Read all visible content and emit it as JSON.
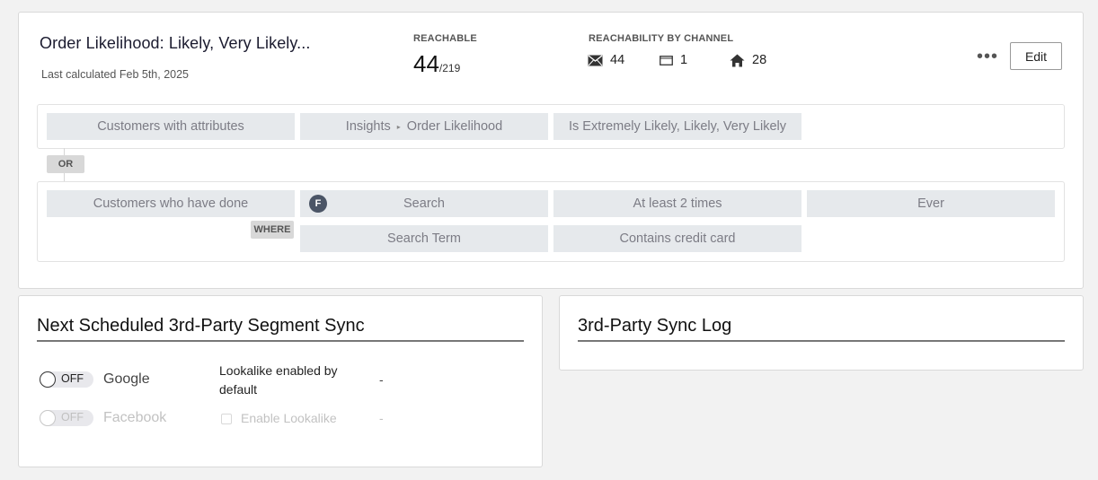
{
  "segment": {
    "title": "Order Likelihood: Likely, Very Likely...",
    "last_calculated": "Last calculated Feb 5th, 2025"
  },
  "reachable": {
    "label": "REACHABLE",
    "count": "44",
    "total": "/219"
  },
  "channels": {
    "label": "REACHABILITY BY CHANNEL",
    "items": [
      {
        "icon": "email-icon",
        "count": "44"
      },
      {
        "icon": "sms-icon",
        "count": "1"
      },
      {
        "icon": "home-icon",
        "count": "28"
      }
    ]
  },
  "toolbar": {
    "more_label": "•••",
    "edit_label": "Edit"
  },
  "conditions": {
    "group1": {
      "type": "Customers with attributes",
      "attribute_source": "Insights",
      "attribute_name": "Order Likelihood",
      "operator": "Is Extremely Likely, Likely, Very Likely"
    },
    "joiner": "OR",
    "group2": {
      "type": "Customers who have done",
      "event_badge": "F",
      "event": "Search",
      "frequency": "At least 2 times",
      "timeframe": "Ever",
      "where_label": "WHERE",
      "property": "Search Term",
      "property_operator": "Contains credit card"
    }
  },
  "sync": {
    "title": "Next Scheduled 3rd-Party Segment Sync",
    "lookalike_enabled_label": "Lookalike enabled by default",
    "platforms": [
      {
        "name": "Google",
        "toggle": "OFF",
        "value": "-",
        "disabled": false
      },
      {
        "name": "Facebook",
        "toggle": "OFF",
        "value": "-",
        "disabled": true,
        "checkbox_label": "Enable Lookalike"
      }
    ]
  },
  "log": {
    "title": "3rd-Party Sync Log"
  }
}
